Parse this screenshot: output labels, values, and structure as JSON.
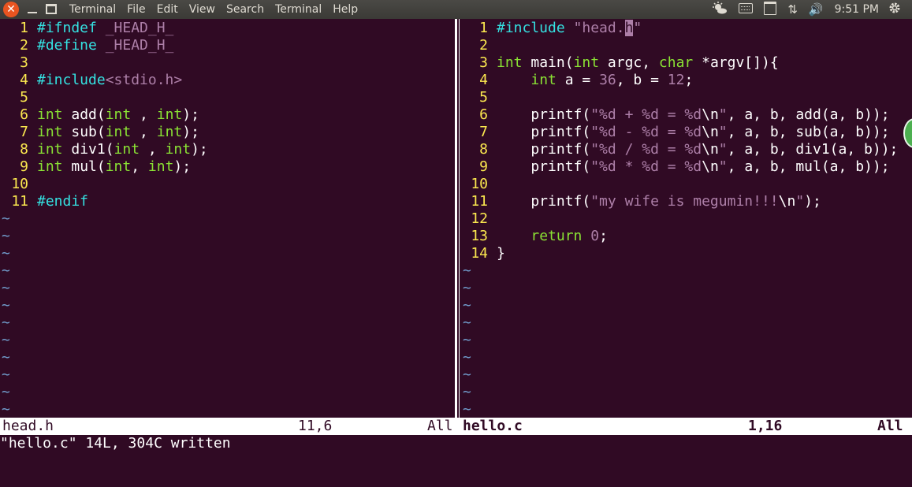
{
  "topbar": {
    "close_glyph": "✕",
    "menus": [
      "Terminal",
      "File",
      "Edit",
      "View",
      "Search",
      "Terminal",
      "Help"
    ],
    "indicators": {
      "network_glyph": "⇅",
      "volume_glyph": "🔊",
      "time": "9:51 PM"
    }
  },
  "left_pane": {
    "lines": [
      {
        "n": "1",
        "parts": [
          [
            "cyan",
            "#ifndef "
          ],
          [
            "purple",
            "_HEAD_H_"
          ]
        ]
      },
      {
        "n": "2",
        "parts": [
          [
            "cyan",
            "#define "
          ],
          [
            "purple",
            "_HEAD_H_"
          ]
        ]
      },
      {
        "n": "3",
        "parts": []
      },
      {
        "n": "4",
        "parts": [
          [
            "cyan",
            "#include"
          ],
          [
            "purple",
            "<stdio.h>"
          ]
        ]
      },
      {
        "n": "5",
        "parts": []
      },
      {
        "n": "6",
        "parts": [
          [
            "green",
            "int"
          ],
          [
            "",
            " add("
          ],
          [
            "green",
            "int"
          ],
          [
            "",
            " , "
          ],
          [
            "green",
            "int"
          ],
          [
            "",
            ");"
          ]
        ]
      },
      {
        "n": "7",
        "parts": [
          [
            "green",
            "int"
          ],
          [
            "",
            " sub("
          ],
          [
            "green",
            "int"
          ],
          [
            "",
            " , "
          ],
          [
            "green",
            "int"
          ],
          [
            "",
            ");"
          ]
        ]
      },
      {
        "n": "8",
        "parts": [
          [
            "green",
            "int"
          ],
          [
            "",
            " div1("
          ],
          [
            "green",
            "int"
          ],
          [
            "",
            " , "
          ],
          [
            "green",
            "int"
          ],
          [
            "",
            ");"
          ]
        ]
      },
      {
        "n": "9",
        "parts": [
          [
            "green",
            "int"
          ],
          [
            "",
            " mul("
          ],
          [
            "green",
            "int"
          ],
          [
            "",
            ", "
          ],
          [
            "green",
            "int"
          ],
          [
            "",
            ");"
          ]
        ]
      },
      {
        "n": "10",
        "parts": []
      },
      {
        "n": "11",
        "parts": [
          [
            "cyan",
            "#endif"
          ]
        ]
      }
    ],
    "tilde": "~",
    "tilde_rows": 12
  },
  "right_pane": {
    "lines": [
      {
        "n": "1",
        "parts": [
          [
            "cyan",
            "#include "
          ],
          [
            "purple",
            "\"head."
          ],
          [
            "cursor",
            "h"
          ],
          [
            "purple",
            "\""
          ]
        ]
      },
      {
        "n": "2",
        "parts": []
      },
      {
        "n": "3",
        "parts": [
          [
            "green",
            "int"
          ],
          [
            "",
            " main("
          ],
          [
            "green",
            "int"
          ],
          [
            "",
            " argc, "
          ],
          [
            "green",
            "char"
          ],
          [
            "",
            " *argv[]){"
          ]
        ]
      },
      {
        "n": "4",
        "parts": [
          [
            "",
            "    "
          ],
          [
            "green",
            "int"
          ],
          [
            "",
            " a = "
          ],
          [
            "purple",
            "36"
          ],
          [
            "",
            ", b = "
          ],
          [
            "purple",
            "12"
          ],
          [
            "",
            ";"
          ]
        ]
      },
      {
        "n": "5",
        "parts": []
      },
      {
        "n": "6",
        "parts": [
          [
            "",
            "    printf("
          ],
          [
            "purple",
            "\"%d + %d = %d"
          ],
          [
            "",
            "\\n"
          ],
          [
            "purple",
            "\""
          ],
          [
            "",
            ", a, b, add(a, b));"
          ]
        ]
      },
      {
        "n": "7",
        "parts": [
          [
            "",
            "    printf("
          ],
          [
            "purple",
            "\"%d - %d = %d"
          ],
          [
            "",
            "\\n"
          ],
          [
            "purple",
            "\""
          ],
          [
            "",
            ", a, b, sub(a, b));"
          ]
        ]
      },
      {
        "n": "8",
        "parts": [
          [
            "",
            "    printf("
          ],
          [
            "purple",
            "\"%d / %d = %d"
          ],
          [
            "",
            "\\n"
          ],
          [
            "purple",
            "\""
          ],
          [
            "",
            ", a, b, div1(a, b));"
          ]
        ]
      },
      {
        "n": "9",
        "parts": [
          [
            "",
            "    printf("
          ],
          [
            "purple",
            "\"%d * %d = %d"
          ],
          [
            "",
            "\\n"
          ],
          [
            "purple",
            "\""
          ],
          [
            "",
            ", a, b, mul(a, b));"
          ]
        ]
      },
      {
        "n": "10",
        "parts": []
      },
      {
        "n": "11",
        "parts": [
          [
            "",
            "    printf("
          ],
          [
            "purple",
            "\"my wife is megumin!!!"
          ],
          [
            "",
            "\\n"
          ],
          [
            "purple",
            "\""
          ],
          [
            "",
            ");"
          ]
        ]
      },
      {
        "n": "12",
        "parts": []
      },
      {
        "n": "13",
        "parts": [
          [
            "",
            "    "
          ],
          [
            "green",
            "return"
          ],
          [
            "",
            " "
          ],
          [
            "purple",
            "0"
          ],
          [
            "",
            ";"
          ]
        ]
      },
      {
        "n": "14",
        "parts": [
          [
            "",
            "}"
          ]
        ]
      }
    ],
    "tilde": "~",
    "tilde_rows": 9
  },
  "status": {
    "left": {
      "file": "head.h",
      "pos": "11,6",
      "scroll": "All"
    },
    "right": {
      "file": "hello.c",
      "pos": "1,16",
      "scroll": "All"
    }
  },
  "cmdline": "\"hello.c\" 14L, 304C written"
}
